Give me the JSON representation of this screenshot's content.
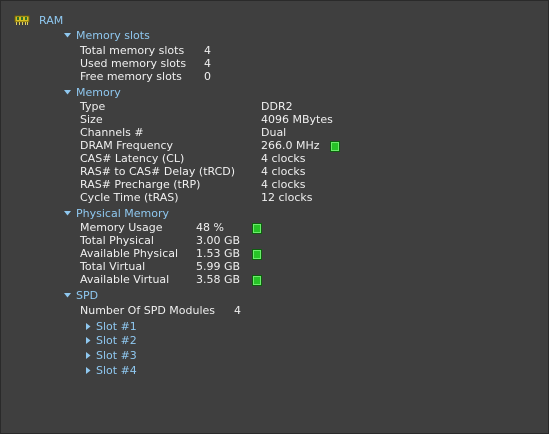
{
  "root": {
    "label": "RAM"
  },
  "memory_slots": {
    "title": "Memory slots",
    "rows": [
      {
        "key": "Total memory slots",
        "value": "4"
      },
      {
        "key": "Used memory slots",
        "value": "4"
      },
      {
        "key": "Free memory slots",
        "value": "0"
      }
    ]
  },
  "memory": {
    "title": "Memory",
    "rows": [
      {
        "key": "Type",
        "value": "DDR2"
      },
      {
        "key": "Size",
        "value": "4096 MBytes"
      },
      {
        "key": "Channels #",
        "value": "Dual"
      },
      {
        "key": "DRAM Frequency",
        "value": "266.0 MHz"
      },
      {
        "key": "CAS# Latency (CL)",
        "value": "4 clocks"
      },
      {
        "key": "RAS# to CAS# Delay (tRCD)",
        "value": "4 clocks"
      },
      {
        "key": "RAS# Precharge (tRP)",
        "value": "4 clocks"
      },
      {
        "key": "Cycle Time (tRAS)",
        "value": "12 clocks"
      }
    ]
  },
  "physical_memory": {
    "title": "Physical Memory",
    "rows": [
      {
        "key": "Memory Usage",
        "value": "48 %"
      },
      {
        "key": "Total Physical",
        "value": "3.00 GB"
      },
      {
        "key": "Available Physical",
        "value": "1.53 GB"
      },
      {
        "key": "Total Virtual",
        "value": "5.99 GB"
      },
      {
        "key": "Available Virtual",
        "value": "3.58 GB"
      }
    ]
  },
  "spd": {
    "title": "SPD",
    "modules_key": "Number Of SPD Modules",
    "modules_value": "4",
    "slots": [
      "Slot #1",
      "Slot #2",
      "Slot #3",
      "Slot #4"
    ]
  },
  "colors": {
    "background": "#3f3f3f",
    "link": "#8fc8f0",
    "indicator": "#27c427"
  },
  "icons": [
    "ram-chip-icon",
    "expanded-arrow-icon",
    "collapsed-arrow-icon",
    "status-indicator-icon"
  ]
}
